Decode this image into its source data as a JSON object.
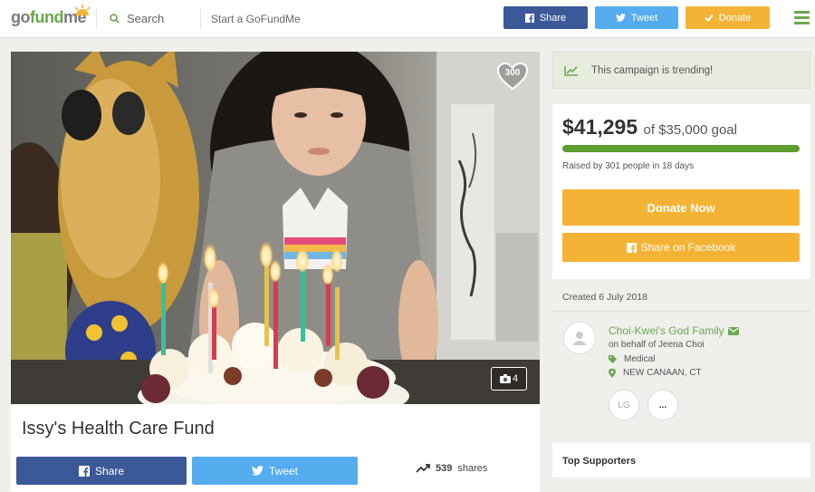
{
  "colors": {
    "brand_green": "#6aa84f",
    "facebook_blue": "#3b5998",
    "twitter_blue": "#55acee",
    "donate_orange": "#f5b335",
    "progress_green": "#5d9c2f"
  },
  "header": {
    "logo_part1": "go",
    "logo_part2": "fund",
    "logo_part3": "me",
    "search_label": "Search",
    "start_link": "Start a GoFundMe",
    "share_label": "Share",
    "tweet_label": "Tweet",
    "donate_label": "Donate"
  },
  "campaign": {
    "hearts": "300",
    "photo_count": "4",
    "title": "Issy's Health Care Fund",
    "share_label": "Share",
    "tweet_label": "Tweet",
    "shares_count": "539",
    "shares_suffix": "shares"
  },
  "sidebar": {
    "trending_text": "This campaign is trending!",
    "raised_amount": "$41,295",
    "goal_text": "of $35,000 goal",
    "progress_fraction": 1.0,
    "raised_by_text": "Raised by 301 people in 18 days",
    "donate_now_label": "Donate Now",
    "share_facebook_label": "Share on Facebook",
    "created_text": "Created 6 July 2018",
    "organizer_name": "Choi-Kwei's God Family",
    "on_behalf_text": "on behalf of Jeena Choi",
    "category": "Medical",
    "location": "NEW CANAAN, CT",
    "avatar_initials": "LG",
    "more_label": "...",
    "top_supporters_label": "Top Supporters"
  },
  "icons": [
    "search-icon",
    "facebook-icon",
    "twitter-icon",
    "checkmark-icon",
    "hamburger-menu-icon",
    "heart-icon",
    "camera-icon",
    "trending-icon",
    "envelope-icon",
    "tag-icon",
    "location-pin-icon",
    "user-icon"
  ]
}
